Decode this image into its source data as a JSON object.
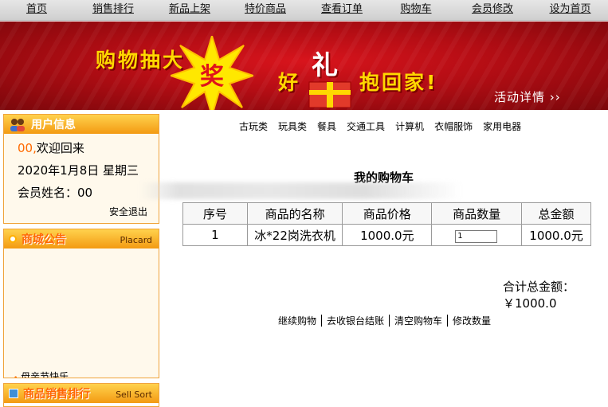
{
  "topnav": [
    {
      "label": "首页"
    },
    {
      "label": "销售排行"
    },
    {
      "label": "新品上架"
    },
    {
      "label": "特价商品"
    },
    {
      "label": "查看订单"
    },
    {
      "label": "购物车"
    },
    {
      "label": "会员修改"
    },
    {
      "label": "设为首页"
    }
  ],
  "banner": {
    "line1": "购物抽大",
    "line1_star": "奖",
    "line2_a": "好",
    "line2_li": "礼",
    "line2_b": "抱回家!",
    "detail": "活动详情 ››"
  },
  "user_panel": {
    "title": "用户信息",
    "welcome_prefix": "00,",
    "welcome_text": "欢迎回来",
    "date": "2020年1月8日 星期三",
    "member": "会员姓名：00",
    "logout": "安全退出"
  },
  "placard_panel": {
    "title": "商城公告",
    "title_en": "Placard",
    "item": "母亲节快乐"
  },
  "sellsort_panel": {
    "title": "商品销售排行",
    "title_en": "Sell Sort"
  },
  "categories": [
    "古玩类",
    "玩具类",
    "餐具",
    "交通工具",
    "计算机",
    "衣帽服饰",
    "家用电器"
  ],
  "cart": {
    "title": "我的购物车",
    "headers": [
      "序号",
      "商品的名称",
      "商品价格",
      "商品数量",
      "总金额"
    ],
    "rows": [
      {
        "index": "1",
        "name": "冰*22岗洗衣机",
        "price": "1000.0元",
        "qty": "1",
        "total": "1000.0元"
      }
    ],
    "total_label": "合计总金额：",
    "total_value": "￥1000.0",
    "actions": [
      "继续购物",
      "去收银台结账",
      "清空购物车",
      "修改数量"
    ]
  },
  "colors": {
    "banner_red": "#c0111a",
    "gold_text": "#ffd800",
    "panel_orange": "#f39a12",
    "accent_orange": "#ff6a00"
  }
}
